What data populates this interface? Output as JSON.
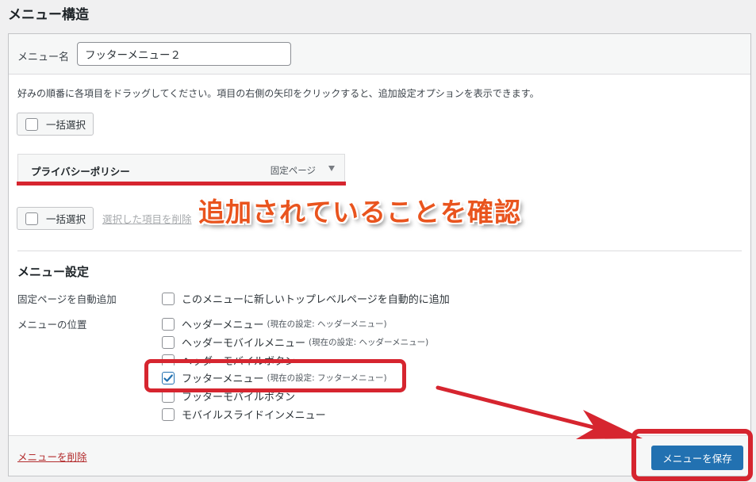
{
  "page": {
    "title": "メニュー構造"
  },
  "menu_name": {
    "label": "メニュー名",
    "value": "フッターメニュー２"
  },
  "instructions": "好みの順番に各項目をドラッグしてください。項目の右側の矢印をクリックすると、追加設定オプションを表示できます。",
  "bulk_select_label": "一括選択",
  "menu_item": {
    "title": "プライバシーポリシー",
    "type": "固定ページ"
  },
  "bulk_delete_label": "選択した項目を削除",
  "annotation": {
    "text": "追加されていることを確認",
    "color": "#e9541e",
    "highlight_color": "#d6252f"
  },
  "settings": {
    "title": "メニュー設定",
    "auto_add": {
      "label": "固定ページを自動追加",
      "option": "このメニューに新しいトップレベルページを自動的に追加",
      "checked": false
    },
    "locations_label": "メニューの位置",
    "locations": [
      {
        "label": "ヘッダーメニュー",
        "current": "(現在の設定: ヘッダーメニュー)",
        "checked": false
      },
      {
        "label": "ヘッダーモバイルメニュー",
        "current": "(現在の設定: ヘッダーメニュー)",
        "checked": false
      },
      {
        "label": "ヘッダーモバイルボタン",
        "current": "",
        "checked": false
      },
      {
        "label": "フッターメニュー",
        "current": "(現在の設定: フッターメニュー)",
        "checked": true
      },
      {
        "label": "フッターモバイルボタン",
        "current": "",
        "checked": false
      },
      {
        "label": "モバイルスライドインメニュー",
        "current": "",
        "checked": false
      }
    ]
  },
  "footer": {
    "delete_label": "メニューを削除",
    "save_label": "メニューを保存"
  },
  "colors": {
    "primary": "#2271b1",
    "danger_link": "#b32d2e"
  }
}
